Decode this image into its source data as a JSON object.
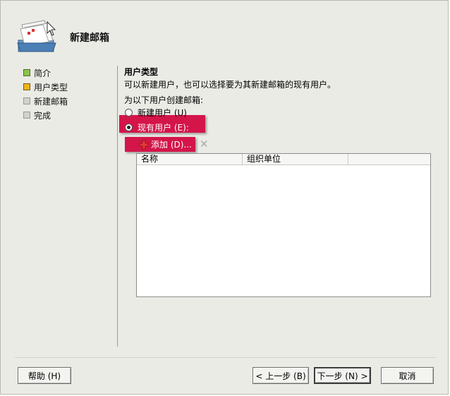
{
  "dialog": {
    "title": "新建邮箱"
  },
  "nav": {
    "items": [
      {
        "label": "简介",
        "state": "done"
      },
      {
        "label": "用户类型",
        "state": "current"
      },
      {
        "label": "新建邮箱",
        "state": "pending"
      },
      {
        "label": "完成",
        "state": "pending"
      }
    ]
  },
  "content": {
    "section_title": "用户类型",
    "section_desc": "可以新建用户，也可以选择要为其新建邮箱的现有用户。",
    "create_label": "为以下用户创建邮箱:",
    "options": [
      {
        "label": "新建用户 (U)",
        "checked": false
      },
      {
        "label": "现有用户 (E):",
        "checked": true
      }
    ],
    "add_button": "添加 (D)...",
    "remove_icon": "remove-icon",
    "grid": {
      "columns": [
        "名称",
        "组织单位",
        ""
      ],
      "rows": []
    }
  },
  "buttons": {
    "help": "帮助 (H)",
    "back": "< 上一步 (B)",
    "next": "下一步 (N) >",
    "cancel": "取消"
  },
  "colors": {
    "highlight": "#d4154a",
    "dialog_bg": "#ebebe6",
    "nav_done": "#8ec34a",
    "nav_current": "#f0b21c"
  }
}
